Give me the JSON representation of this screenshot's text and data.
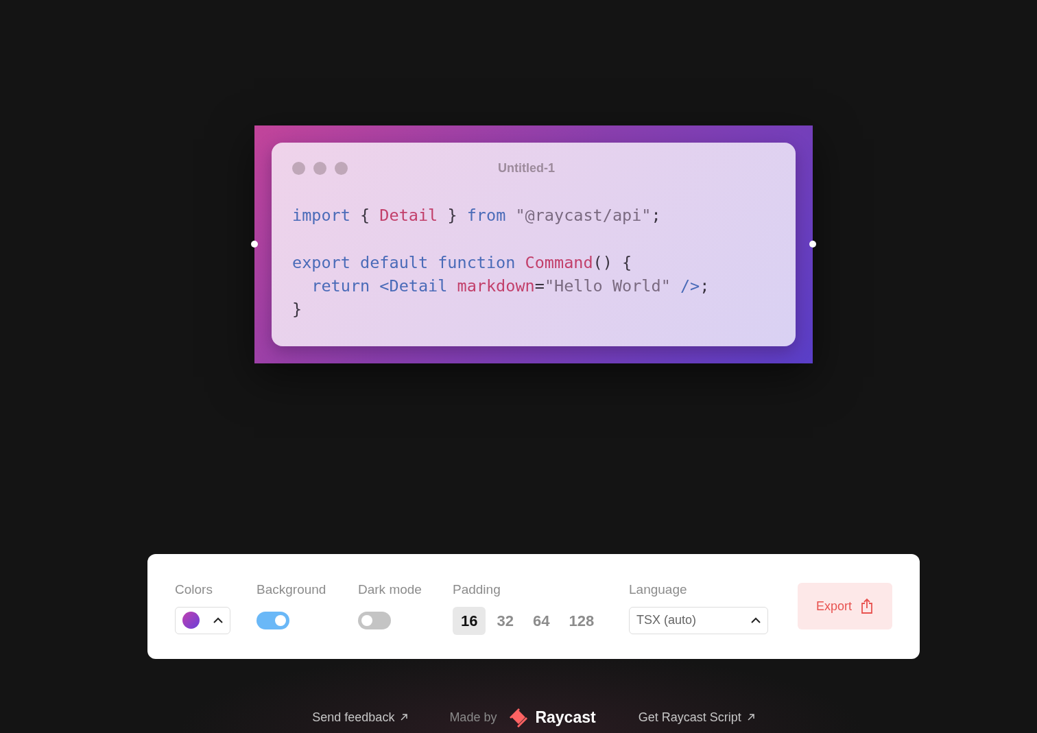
{
  "editor": {
    "title": "Untitled-1",
    "lines": [
      {
        "gap_before": false,
        "tokens": [
          {
            "text": "import",
            "kind": "keyword"
          },
          {
            "text": " { ",
            "kind": "plain"
          },
          {
            "text": "Detail",
            "kind": "name"
          },
          {
            "text": " } ",
            "kind": "plain"
          },
          {
            "text": "from",
            "kind": "keyword"
          },
          {
            "text": " \"@raycast/api\"",
            "kind": "string"
          },
          {
            "text": ";",
            "kind": "plain"
          }
        ]
      },
      {
        "gap_before": true,
        "tokens": [
          {
            "text": "export default function ",
            "kind": "keyword"
          },
          {
            "text": "Command",
            "kind": "name"
          },
          {
            "text": "() {",
            "kind": "plain"
          }
        ]
      },
      {
        "gap_before": false,
        "tokens": [
          {
            "text": "  return <Detail ",
            "kind": "keyword"
          },
          {
            "text": "markdown",
            "kind": "name"
          },
          {
            "text": "=",
            "kind": "plain"
          },
          {
            "text": "\"Hello World\" ",
            "kind": "string"
          },
          {
            "text": "/>",
            "kind": "keyword"
          },
          {
            "text": ";",
            "kind": "plain"
          }
        ]
      },
      {
        "gap_before": false,
        "tokens": [
          {
            "text": "}",
            "kind": "plain"
          }
        ]
      }
    ]
  },
  "controls": {
    "colors": {
      "label": "Colors"
    },
    "background": {
      "label": "Background",
      "on": true
    },
    "dark_mode": {
      "label": "Dark mode",
      "on": false
    },
    "padding": {
      "label": "Padding",
      "options": [
        {
          "label": "16",
          "selected": true
        },
        {
          "label": "32",
          "selected": false
        },
        {
          "label": "64",
          "selected": false
        },
        {
          "label": "128",
          "selected": false
        }
      ]
    },
    "language": {
      "label": "Language",
      "value": "TSX (auto)"
    },
    "export": {
      "label": "Export"
    }
  },
  "footer": {
    "feedback": "Send feedback",
    "made_by": "Made by",
    "brand": "Raycast",
    "script": "Get Raycast Script"
  }
}
